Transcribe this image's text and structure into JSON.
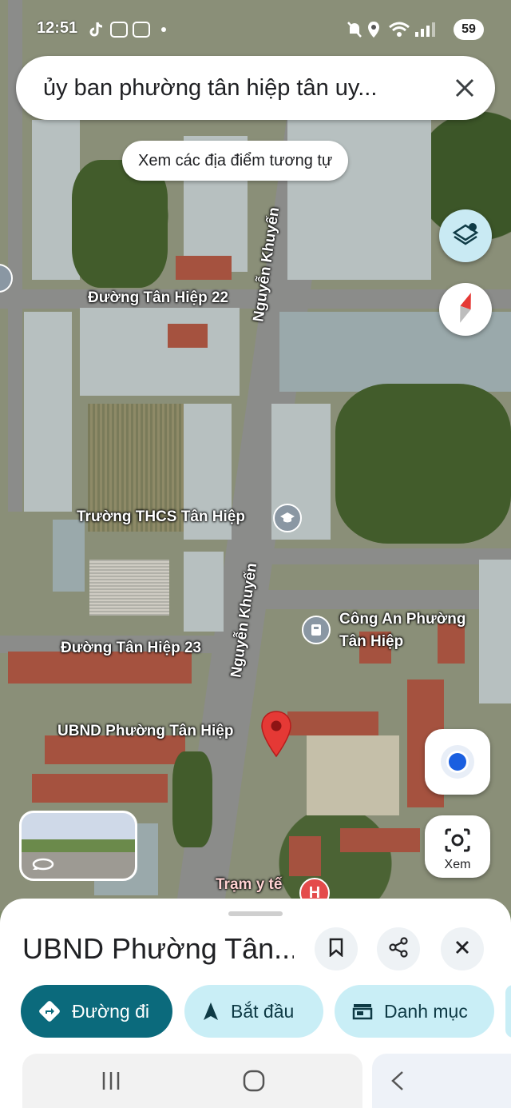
{
  "status_bar": {
    "time": "12:51",
    "battery": "59",
    "apps": [
      "tiktok-icon",
      "zalo-icon",
      "zalo-icon"
    ]
  },
  "search": {
    "query": "ủy ban phường tân hiệp tân uy...",
    "clear_icon": "close-icon"
  },
  "similar_places_label": "Xem các địa điểm tương tự",
  "map": {
    "labels": {
      "road_tan_hiep_22": "Đường Tân Hiệp 22",
      "road_nguyen_khuyen_top": "Nguyễn Khuyến",
      "road_nguyen_khuyen_bottom": "Nguyễn Khuyến",
      "school": "Trường THCS Tân Hiệp",
      "police_line1": "Công An Phường",
      "police_line2": "Tân Hiệp",
      "road_tan_hiep_23": "Đường Tân Hiệp 23",
      "ubnd": "UBND Phường Tân Hiệp",
      "clinic": "Trạm y tế"
    }
  },
  "controls": {
    "lens_label": "Xem"
  },
  "place": {
    "title": "UBND Phường Tân...",
    "actions": {
      "directions": "Đường đi",
      "start": "Bắt đầu",
      "save": "Danh mục"
    }
  },
  "colors": {
    "primary": "#0b6a7c",
    "chip": "#c9eef6",
    "pin": "#e53935"
  }
}
